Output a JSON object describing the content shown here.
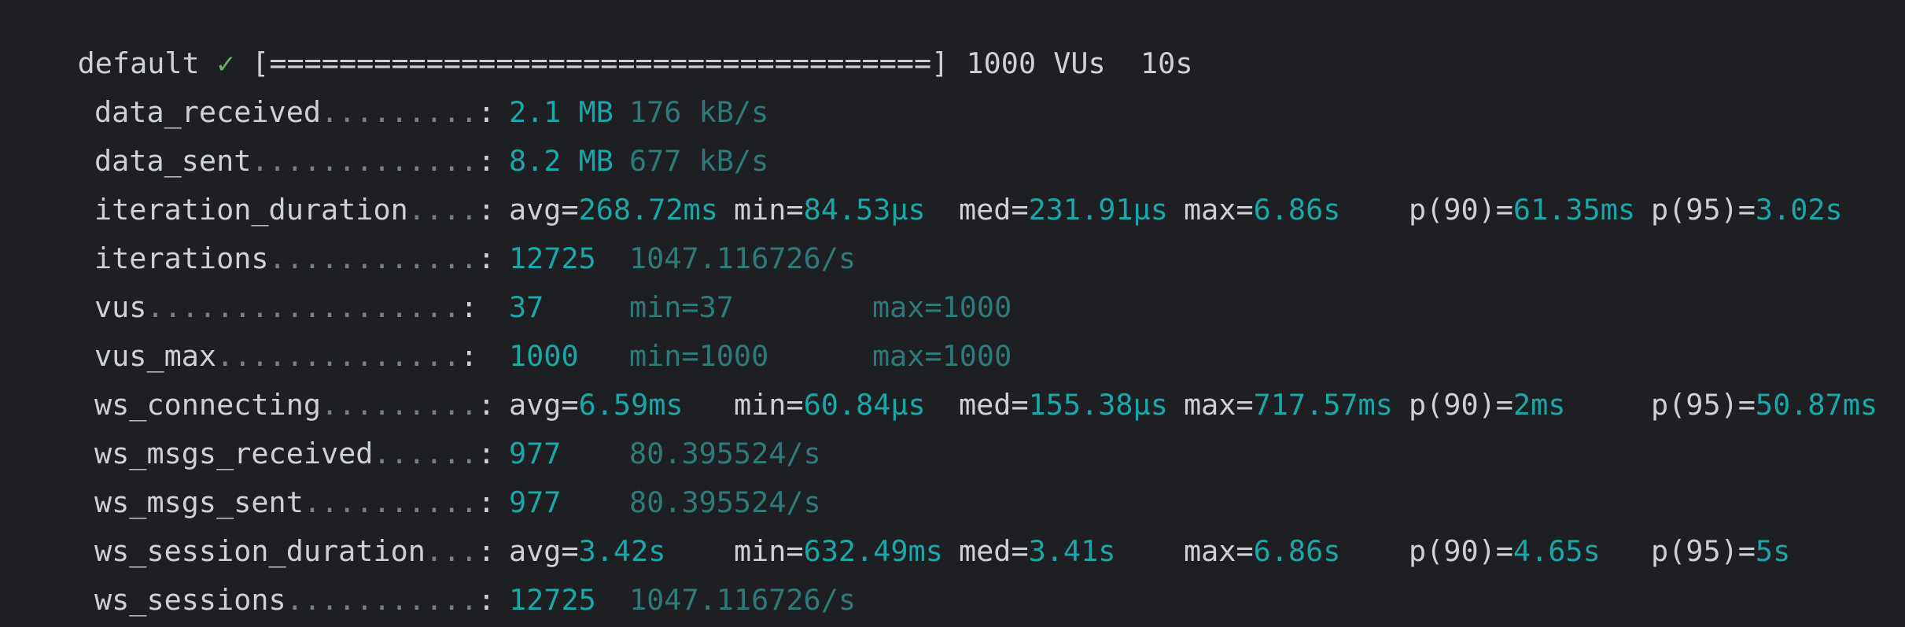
{
  "header": {
    "scenario": "default",
    "check": "✓",
    "progress_bar": "[======================================]",
    "vus": "1000 VUs",
    "duration": "10s"
  },
  "metrics": [
    {
      "name": "data_received",
      "dots": ".........",
      "colon": ":",
      "value": "2.1 MB",
      "rate": "176 kB/s"
    },
    {
      "name": "data_sent",
      "dots": ".............",
      "colon": ":",
      "value": "8.2 MB",
      "rate": "677 kB/s"
    },
    {
      "name": "iteration_duration",
      "dots": "....",
      "colon": ":",
      "avg_k": "avg=",
      "avg": "268.72ms",
      "min_k": "min=",
      "min": "84.53µs",
      "med_k": "med=",
      "med": "231.91µs",
      "max_k": "max=",
      "max": "6.86s",
      "p90_k": "p(90)=",
      "p90": "61.35ms",
      "p95_k": "p(95)=",
      "p95": "3.02s"
    },
    {
      "name": "iterations",
      "dots": "............",
      "colon": ":",
      "value": "12725",
      "rate": "1047.116726/s"
    },
    {
      "name": "vus",
      "dots": "..................",
      "colon": ":",
      "value": "37",
      "min": "min=37",
      "max": "max=1000"
    },
    {
      "name": "vus_max",
      "dots": "..............",
      "colon": ":",
      "value": "1000",
      "min": "min=1000",
      "max": "max=1000"
    },
    {
      "name": "ws_connecting",
      "dots": ".........",
      "colon": ":",
      "avg_k": "avg=",
      "avg": "6.59ms",
      "min_k": "min=",
      "min": "60.84µs",
      "med_k": "med=",
      "med": "155.38µs",
      "max_k": "max=",
      "max": "717.57ms",
      "p90_k": "p(90)=",
      "p90": "2ms",
      "p95_k": "p(95)=",
      "p95": "50.87ms"
    },
    {
      "name": "ws_msgs_received",
      "dots": "......",
      "colon": ":",
      "value": "977",
      "rate": "80.395524/s"
    },
    {
      "name": "ws_msgs_sent",
      "dots": "..........",
      "colon": ":",
      "value": "977",
      "rate": "80.395524/s"
    },
    {
      "name": "ws_session_duration",
      "dots": "...",
      "colon": ":",
      "avg_k": "avg=",
      "avg": "3.42s",
      "min_k": "min=",
      "min": "632.49ms",
      "med_k": "med=",
      "med": "3.41s",
      "max_k": "max=",
      "max": "6.86s",
      "p90_k": "p(90)=",
      "p90": "4.65s",
      "p95_k": "p(95)=",
      "p95": "5s"
    },
    {
      "name": "ws_sessions",
      "dots": "...........",
      "colon": ":",
      "value": "12725",
      "rate": "1047.116726/s"
    }
  ],
  "colors": {
    "background": "#1e1f22",
    "text": "#cdd0d6",
    "value": "#19a7a7",
    "dim_value": "#2e7a7a",
    "dots": "#7a7e85",
    "check": "#5fb35f"
  }
}
